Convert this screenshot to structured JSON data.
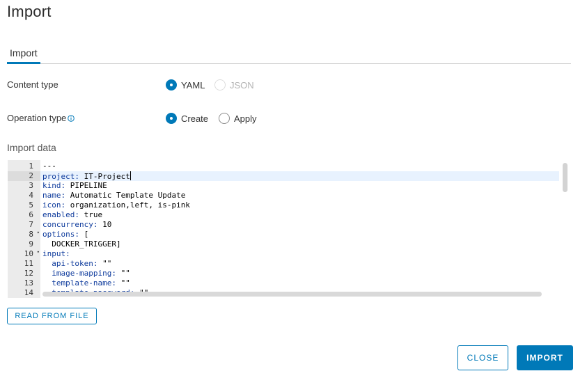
{
  "dialog": {
    "title": "Import"
  },
  "tabs": [
    {
      "label": "Import",
      "active": true
    }
  ],
  "form": {
    "content_type": {
      "label": "Content type",
      "options": [
        {
          "label": "YAML",
          "checked": true,
          "disabled": false
        },
        {
          "label": "JSON",
          "checked": false,
          "disabled": true
        }
      ]
    },
    "operation_type": {
      "label": "Operation type",
      "info_icon": "info-icon",
      "options": [
        {
          "label": "Create",
          "checked": true,
          "disabled": false
        },
        {
          "label": "Apply",
          "checked": false,
          "disabled": false
        }
      ]
    }
  },
  "import_data": {
    "label": "Import data",
    "active_line": 2,
    "lines": [
      {
        "num": "1",
        "key": "",
        "value": "---"
      },
      {
        "num": "2",
        "key": "project:",
        "value": " IT-Project"
      },
      {
        "num": "3",
        "key": "kind:",
        "value": " PIPELINE"
      },
      {
        "num": "4",
        "key": "name:",
        "value": " Automatic Template Update"
      },
      {
        "num": "5",
        "key": "icon:",
        "value": " organization,left, is-pink"
      },
      {
        "num": "6",
        "key": "enabled:",
        "value": " true"
      },
      {
        "num": "7",
        "key": "concurrency:",
        "value": " 10"
      },
      {
        "num": "8",
        "key": "options:",
        "value": " [",
        "fold": true
      },
      {
        "num": "9",
        "key": "",
        "value": "  DOCKER_TRIGGER]"
      },
      {
        "num": "10",
        "key": "input:",
        "value": "",
        "fold": true
      },
      {
        "num": "11",
        "key": "  api-token:",
        "value": " \"\""
      },
      {
        "num": "12",
        "key": "  image-mapping:",
        "value": " \"\""
      },
      {
        "num": "13",
        "key": "  template-name:",
        "value": " \"\""
      },
      {
        "num": "14",
        "key": "  template-password:",
        "value": " \"\""
      }
    ]
  },
  "buttons": {
    "read_from_file": "READ FROM FILE",
    "close": "CLOSE",
    "import": "IMPORT"
  },
  "colors": {
    "accent": "#0079b8",
    "gutter_bg": "#ebebeb",
    "active_line_bg": "#e8f2fe"
  }
}
